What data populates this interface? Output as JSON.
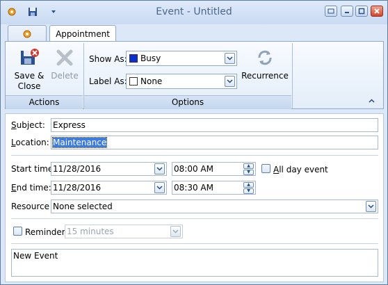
{
  "window": {
    "title": "Event - Untitled"
  },
  "tabs": {
    "appointment": "Appointment"
  },
  "ribbon": {
    "actions": {
      "save_close": "Save &",
      "save_close_2": "Close",
      "delete": "Delete",
      "group": "Actions"
    },
    "options": {
      "show_as_label": "Show As:",
      "show_as_value": "Busy",
      "show_as_color": "#0b2fd1",
      "label_as_label": "Label As:",
      "label_as_value": "None",
      "recurrence": "Recurrence",
      "group": "Options"
    }
  },
  "form": {
    "subject_label": "ubject:",
    "subject_value": "Express",
    "location_label": "ocation:",
    "location_value": "Maintenance",
    "start_label": "Start time:",
    "start_date": "11/28/2016",
    "start_time": "08:00 AM",
    "all_day": "ll day event",
    "end_label": "nd time:",
    "end_date": "11/28/2016",
    "end_time": "08:30 AM",
    "resource_label": "Resource",
    "resource_value": "None selected",
    "reminder_label": "Reminder:",
    "reminder_value": "15 minutes",
    "notes": "New Event"
  }
}
